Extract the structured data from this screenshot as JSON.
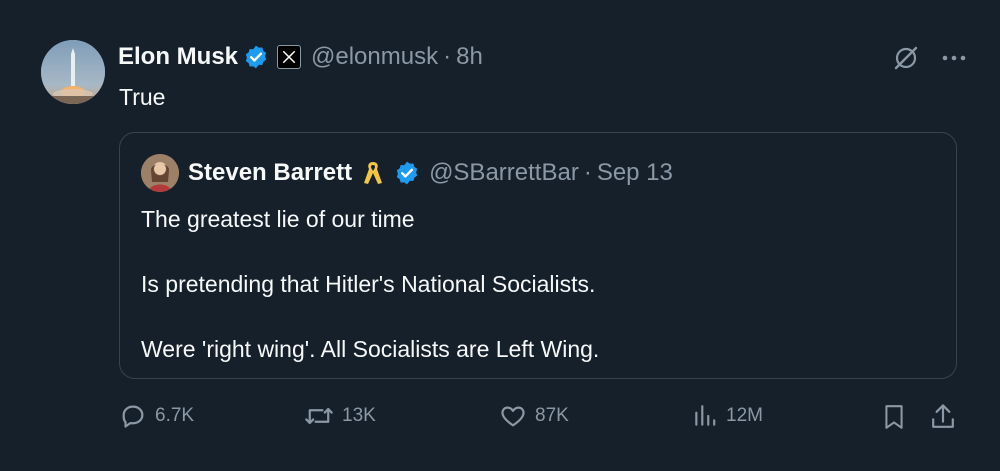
{
  "author": {
    "name": "Elon Musk",
    "handle": "@elonmusk",
    "separator": "·",
    "time": "8h"
  },
  "text": "True",
  "quote": {
    "author": {
      "name": "Steven Barrett",
      "handle": "@SBarrettBar",
      "separator": "·",
      "date": "Sep 13"
    },
    "paragraphs": [
      "The greatest lie of our time",
      "Is pretending that Hitler's National Socialists.",
      "Were 'right wing'. All Socialists are Left Wing."
    ]
  },
  "actions": {
    "replies": "6.7K",
    "reposts": "13K",
    "likes": "87K",
    "views": "12M"
  },
  "icons": {
    "verified": "verified-badge-icon",
    "affiliate": "x-logo-icon",
    "grok": "grok-icon",
    "more": "more-icon",
    "ribbon": "yellow-ribbon-icon",
    "reply": "reply-icon",
    "repost": "repost-icon",
    "like": "heart-icon",
    "views": "views-icon",
    "bookmark": "bookmark-icon",
    "share": "share-icon"
  },
  "colors": {
    "background": "#15202b",
    "text": "#f7f9f9",
    "secondary": "#8b98a5",
    "verified": "#1d9bf0",
    "border": "#38444d",
    "ribbon": "#f4c542"
  }
}
